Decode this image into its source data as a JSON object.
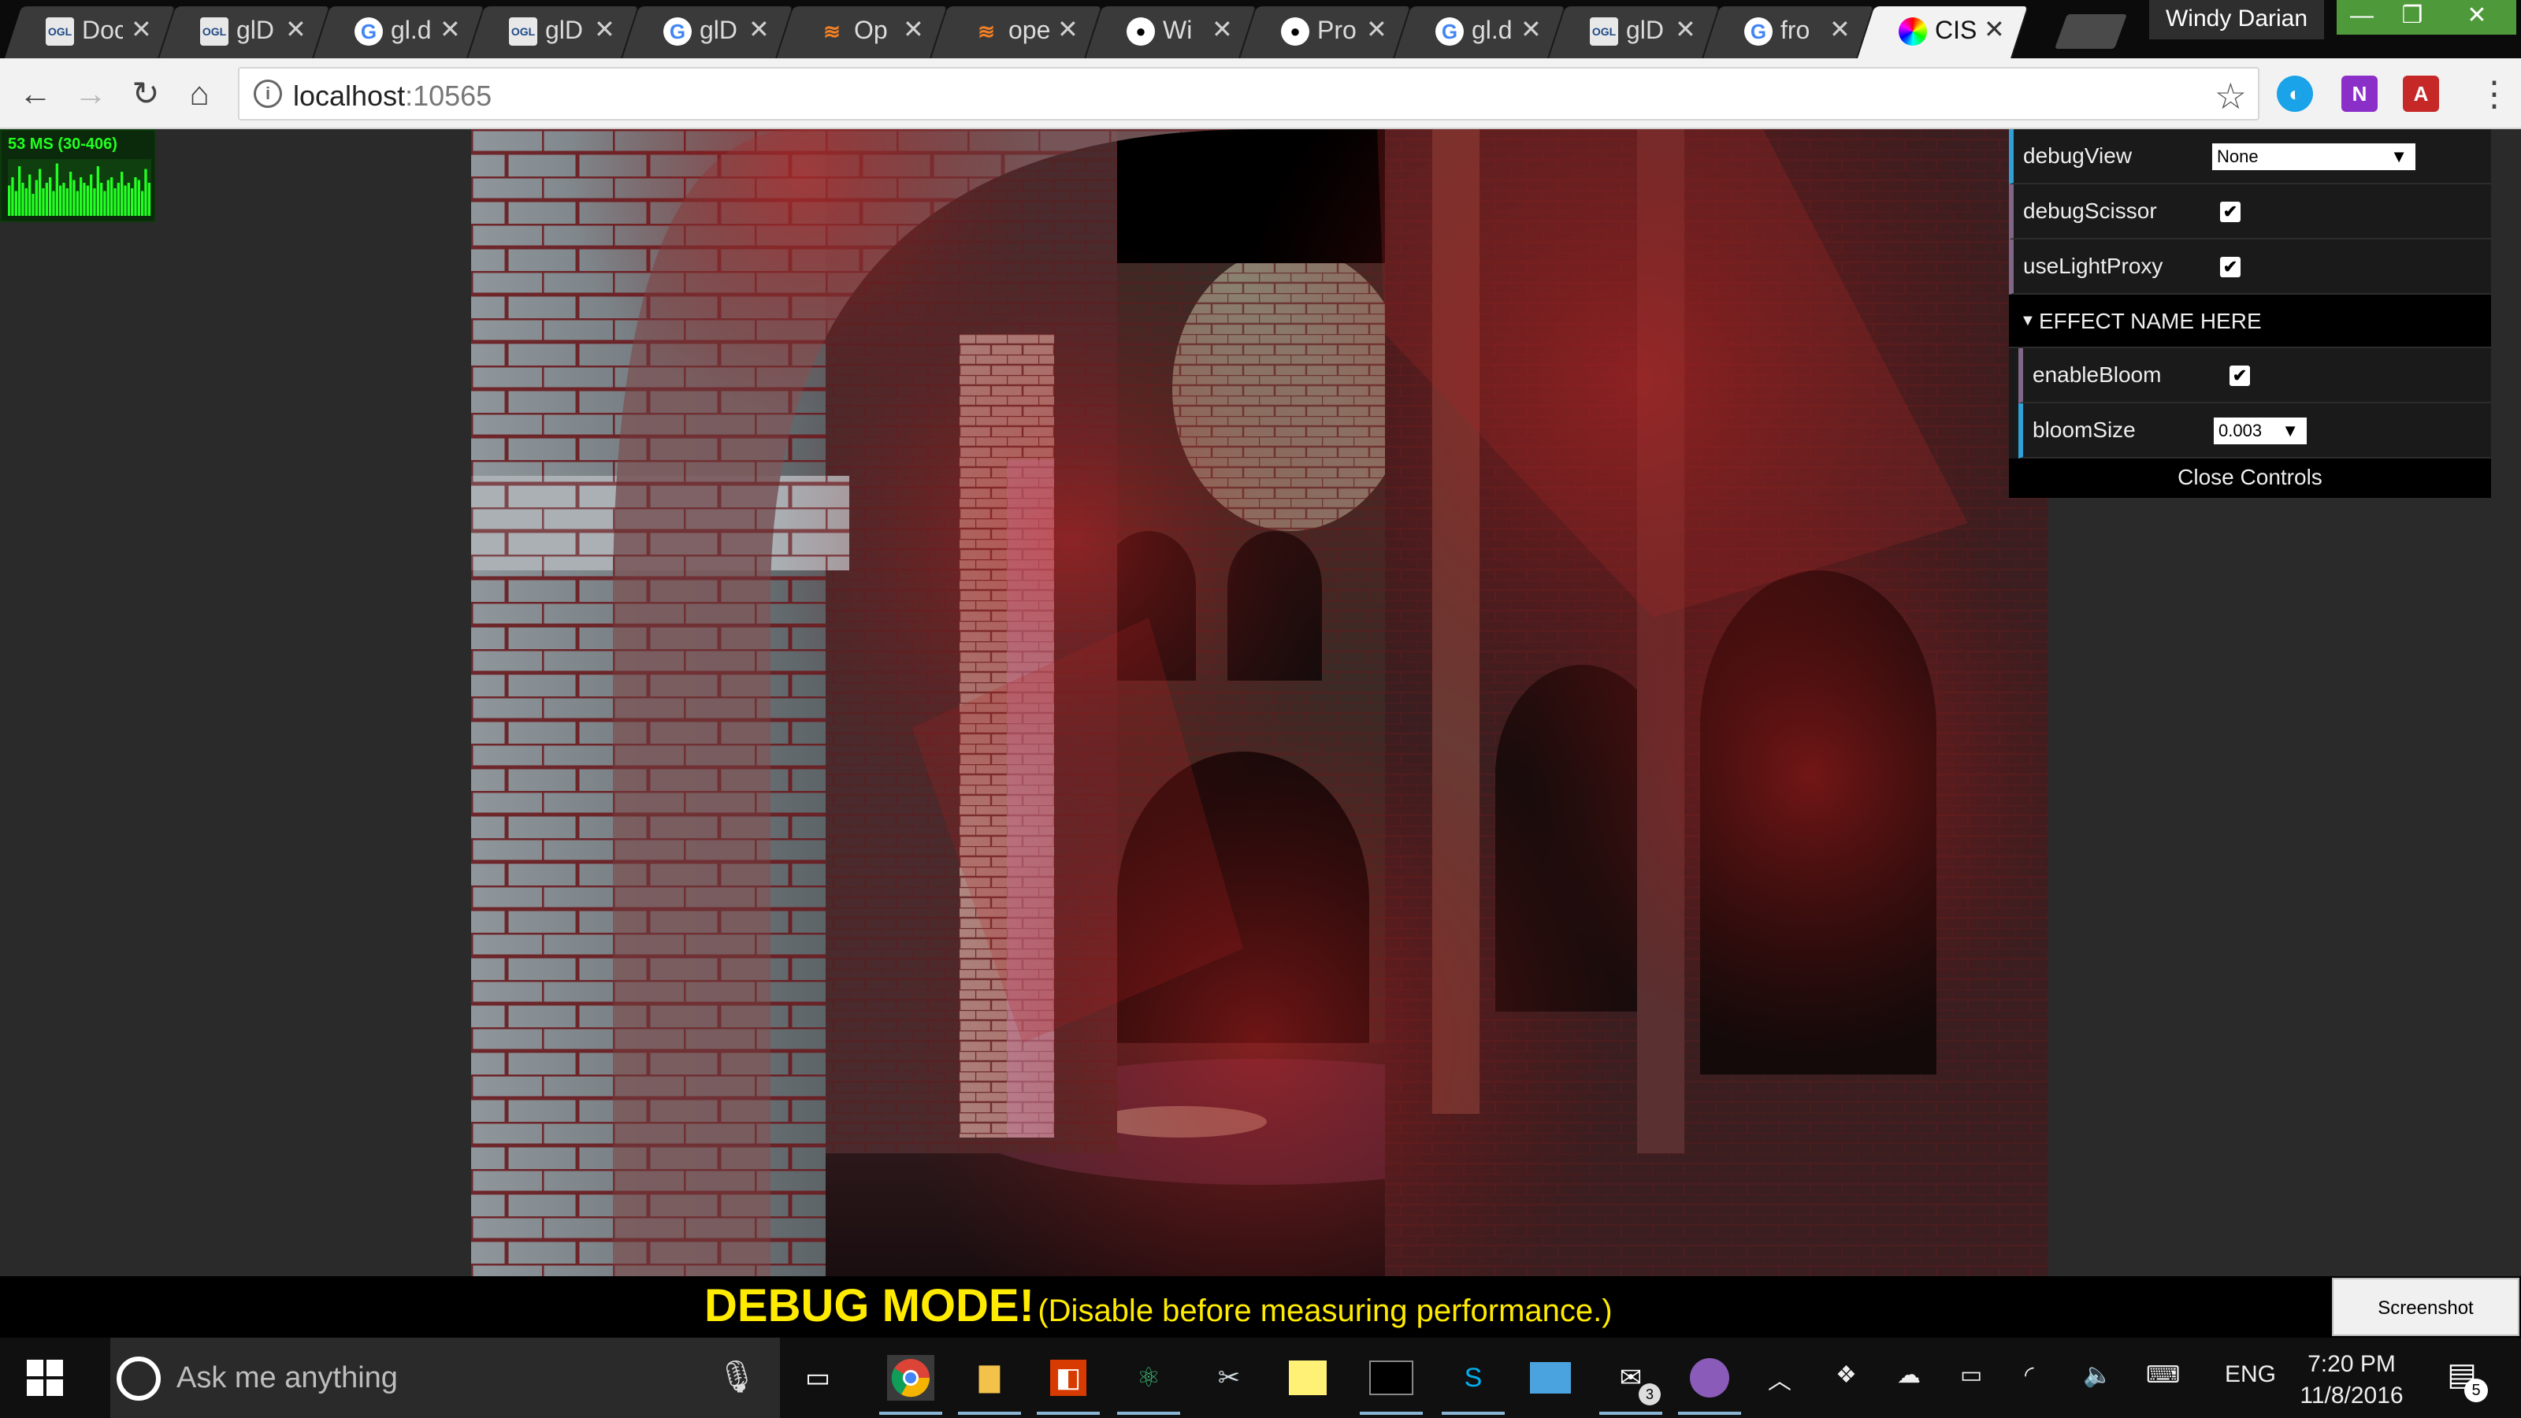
{
  "browser": {
    "tabs": [
      {
        "icon": "ogl-icon",
        "label": "Doc"
      },
      {
        "icon": "ogl-icon",
        "label": "glD"
      },
      {
        "icon": "google-icon",
        "label": "gl.d"
      },
      {
        "icon": "ogl-icon",
        "label": "glD"
      },
      {
        "icon": "google-icon",
        "label": "glD"
      },
      {
        "icon": "stackoverflow-icon",
        "label": "Op"
      },
      {
        "icon": "stackoverflow-icon",
        "label": "ope"
      },
      {
        "icon": "github-icon",
        "label": "Wi"
      },
      {
        "icon": "github-icon",
        "label": "Pro"
      },
      {
        "icon": "google-icon",
        "label": "gl.d"
      },
      {
        "icon": "ogl-icon",
        "label": "glD"
      },
      {
        "icon": "google-icon",
        "label": "fro"
      },
      {
        "icon": "cis-icon",
        "label": "CIS",
        "active": true
      }
    ],
    "user": "Windy Darian",
    "window_buttons": {
      "minimize": "—",
      "maximize": "❐",
      "close": "✕"
    },
    "address": {
      "host": "localhost",
      "port": ":10565"
    }
  },
  "stats": {
    "text": "53 MS (30-406)",
    "bars": [
      0.55,
      0.7,
      0.45,
      0.9,
      0.6,
      0.5,
      0.75,
      0.4,
      0.65,
      0.85,
      0.5,
      0.6,
      0.7,
      0.45,
      0.95,
      0.55,
      0.6,
      0.5,
      0.8,
      0.65,
      0.45,
      0.7,
      0.6,
      0.55,
      0.75,
      0.5,
      0.9,
      0.6,
      0.45,
      0.65,
      0.7,
      0.5,
      0.6,
      0.8,
      0.55,
      0.6,
      0.5,
      0.7,
      0.65,
      0.45,
      0.85,
      0.6
    ]
  },
  "controls": {
    "debugView": {
      "label": "debugView",
      "value": "None"
    },
    "debugScissor": {
      "label": "debugScissor",
      "checked": true
    },
    "useLightProxy": {
      "label": "useLightProxy",
      "checked": true
    },
    "folder": {
      "title": "EFFECT NAME HERE"
    },
    "enableBloom": {
      "label": "enableBloom",
      "checked": true
    },
    "bloomSize": {
      "label": "bloomSize",
      "value": "0.003"
    },
    "close_label": "Close Controls",
    "check_glyph": "✔",
    "arrow_glyph": "▼",
    "folder_glyph": "▼"
  },
  "debug": {
    "title": "DEBUG MODE!",
    "note": "(Disable before measuring performance.)",
    "screenshot_label": "Screenshot"
  },
  "taskbar": {
    "search_placeholder": "Ask me anything",
    "apps": [
      "chrome-icon",
      "file-explorer-icon",
      "office-icon",
      "atom-icon",
      "snipping-icon",
      "sticky-notes-icon",
      "terminal-icon",
      "skype-icon",
      "photos-icon",
      "mail-icon",
      "github-desktop-icon"
    ],
    "mail_badge": "3",
    "language": "ENG",
    "time": "7:20 PM",
    "date": "11/8/2016",
    "notifications": "5"
  }
}
